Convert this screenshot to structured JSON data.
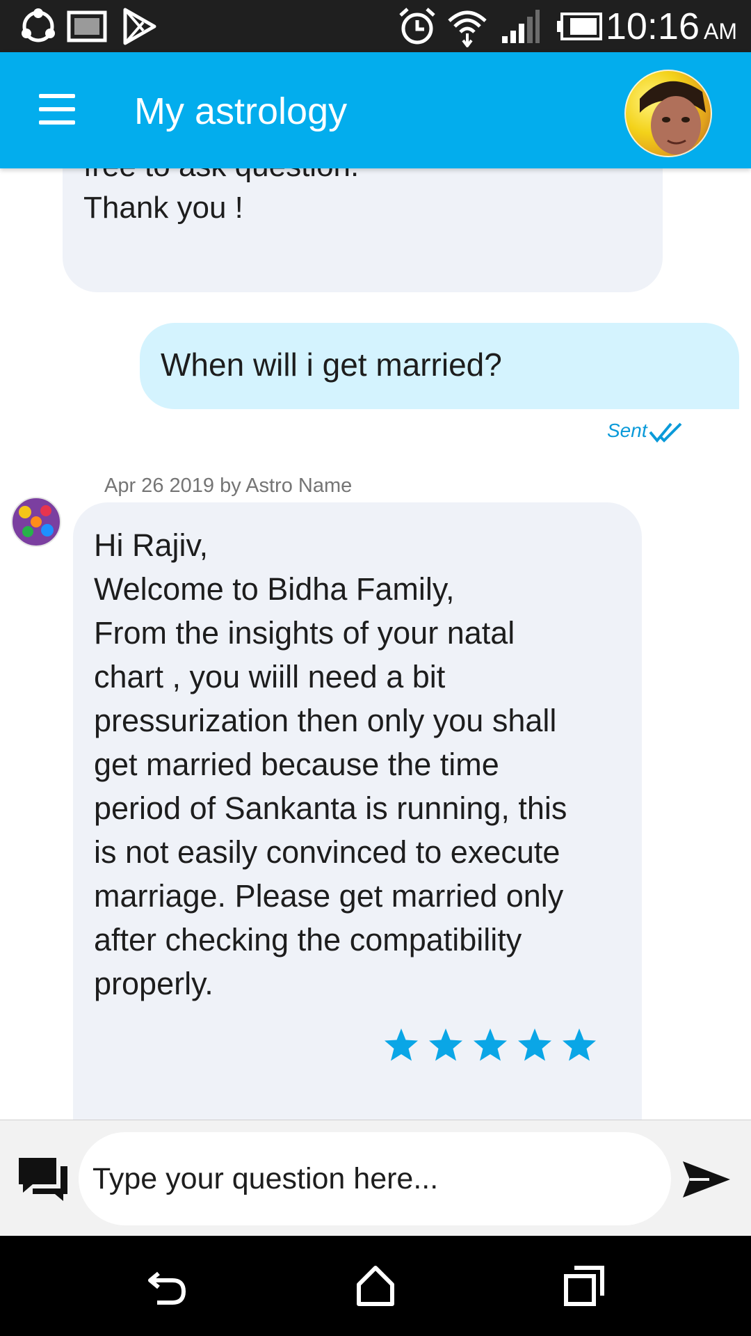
{
  "status_bar": {
    "time": "10:16",
    "am_pm": "AM",
    "icons": [
      "sync-icon",
      "gallery-icon",
      "play-store-icon",
      "alarm-icon",
      "wifi-icon",
      "signal-icon",
      "battery-icon"
    ]
  },
  "app_bar": {
    "title": "My astrology",
    "menu_icon": "hamburger-menu-icon",
    "avatar": "user-avatar"
  },
  "messages": {
    "previous_answer": {
      "partial_line": "free to ask question.",
      "closing": "Thank you !"
    },
    "user_question": {
      "text": "When will i get married?",
      "status": "Sent"
    },
    "astro_answer": {
      "meta": "Apr 26 2019 by Astro Name",
      "lines": [
        "Hi Rajiv,",
        "Welcome to Bidha Family,",
        "From the insights of your natal",
        "chart , you wiill need a bit",
        "pressurization then only you shall",
        "get married because the time",
        "period of Sankanta is running, this",
        "is not easily convinced to execute",
        "marriage. Please get married only",
        "after checking the compatibility",
        "properly."
      ],
      "rating": 5,
      "rating_max": 5
    }
  },
  "input_bar": {
    "placeholder": "Type your question here..."
  },
  "colors": {
    "primary": "#03aded",
    "outgoing_bubble": "#d4f3fe",
    "incoming_bubble": "#eff2f8",
    "star": "#0aa6e6"
  }
}
